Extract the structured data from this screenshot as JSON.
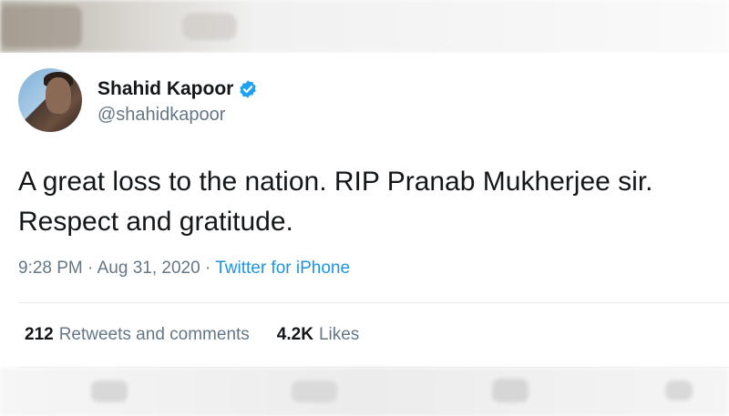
{
  "tweet": {
    "display_name": "Shahid Kapoor",
    "handle": "@shahidkapoor",
    "text_line1": "A great loss to the nation. RIP Pranab Mukherjee sir.",
    "text_line2": "Respect and gratitude.",
    "time": "9:28 PM",
    "separator": "·",
    "date": "Aug 31, 2020",
    "source": "Twitter for iPhone",
    "retweets_count": "212",
    "retweets_label": "Retweets and comments",
    "likes_count": "4.2K",
    "likes_label": "Likes"
  },
  "colors": {
    "text": "#14171a",
    "secondary": "#657786",
    "link": "#1b95e0",
    "verified": "#1da1f2"
  },
  "icons": {
    "verified": "verified-badge-icon"
  }
}
